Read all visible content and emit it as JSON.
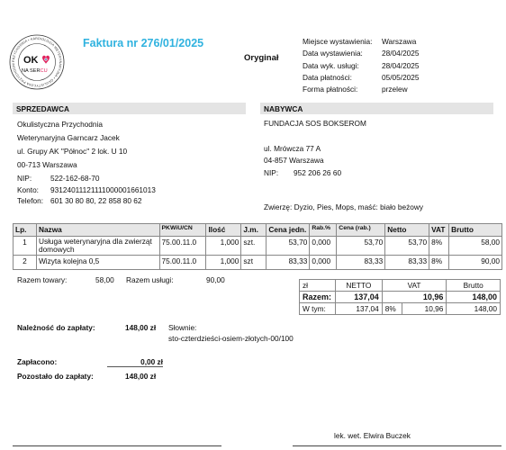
{
  "logo": {
    "ring_text": "PRZYCHODNIA • KARDIOLOGIA WETERYNARYJNA • OKULISTYCZNA PRZYCHODNIA WETERYNARYJNA •",
    "word1": "OK",
    "word2a": "NA SER",
    "word2b": "CU",
    "colors": {
      "accent": "#e0245e",
      "ring": "#333333",
      "eye": "#1f6fb2"
    }
  },
  "title": "Faktura nr 276/01/2025",
  "original_label": "Oryginał",
  "meta": [
    {
      "label": "Miejsce wystawienia:",
      "value": "Warszawa"
    },
    {
      "label": "Data wystawienia:",
      "value": "28/04/2025"
    },
    {
      "label": "Data wyk. usługi:",
      "value": "28/04/2025"
    },
    {
      "label": "Data płatności:",
      "value": "05/05/2025"
    },
    {
      "label": "Forma płatności:",
      "value": "przelew"
    }
  ],
  "seller": {
    "header": "SPRZEDAWCA",
    "lines": [
      "Okulistyczna Przychodnia",
      "Weterynaryjna Garncarz Jacek",
      "ul. Grupy AK \"Północ\" 2 lok. U 10",
      "00-713 Warszawa"
    ],
    "nip_label": "NIP:",
    "nip": "522-162-68-70",
    "konto_label": "Konto:",
    "konto": "93124011121111000001661013",
    "tel_label": "Telefon:",
    "tel": "601 30 80 80, 22 858 80 62"
  },
  "buyer": {
    "header": "NABYWCA",
    "name": "FUNDACJA SOS BOKSEROM",
    "street": "ul. Mrówcza 77 A",
    "city": "04-857 Warszawa",
    "nip_label": "NIP:",
    "nip": "952 206 26 60",
    "animals": "Zwierzę: Dyzio, Pies, Mops, maść: biało beżowy"
  },
  "table": {
    "headers": [
      "Lp.",
      "Nazwa",
      "PKWiU/CN",
      "Ilość",
      "J.m.",
      "Cena jedn.",
      "Rab.%",
      "Cena (rab.)",
      "Netto",
      "VAT",
      "Brutto"
    ],
    "rows": [
      [
        "1",
        "Usługa weterynaryjna dla zwierząt domowych",
        "75.00.11.0",
        "1,000",
        "szt.",
        "53,70",
        "0,000",
        "53,70",
        "53,70",
        "8%",
        "58,00"
      ],
      [
        "2",
        "Wizyta kolejna 0,5",
        "75.00.11.0",
        "1,000",
        "szt",
        "83,33",
        "0,000",
        "83,33",
        "83,33",
        "8%",
        "90,00"
      ]
    ]
  },
  "razem_towary_label": "Razem towary:",
  "razem_towary": "58,00",
  "razem_uslugi_label": "Razem usługi:",
  "razem_uslugi": "90,00",
  "summary": {
    "head": [
      "zł",
      "NETTO",
      "VAT",
      "Brutto"
    ],
    "total": [
      "Razem:",
      "137,04",
      "10,96",
      "148,00"
    ],
    "breakdown": [
      "W tym:",
      "137,04",
      "8%",
      "10,96",
      "148,00"
    ]
  },
  "naleznosc_label": "Należność do zapłaty:",
  "naleznosc": "148,00 zł",
  "slownie_label": "Słownie:",
  "slownie": "sto-czterdzieści-osiem-złotych-00/100",
  "zaplacono_label": "Zapłacono:",
  "zaplacono": "0,00 zł",
  "pozostalo_label": "Pozostało do zapłaty:",
  "pozostalo": "148,00 zł",
  "signer": "lek. wet. Elwira Buczek"
}
